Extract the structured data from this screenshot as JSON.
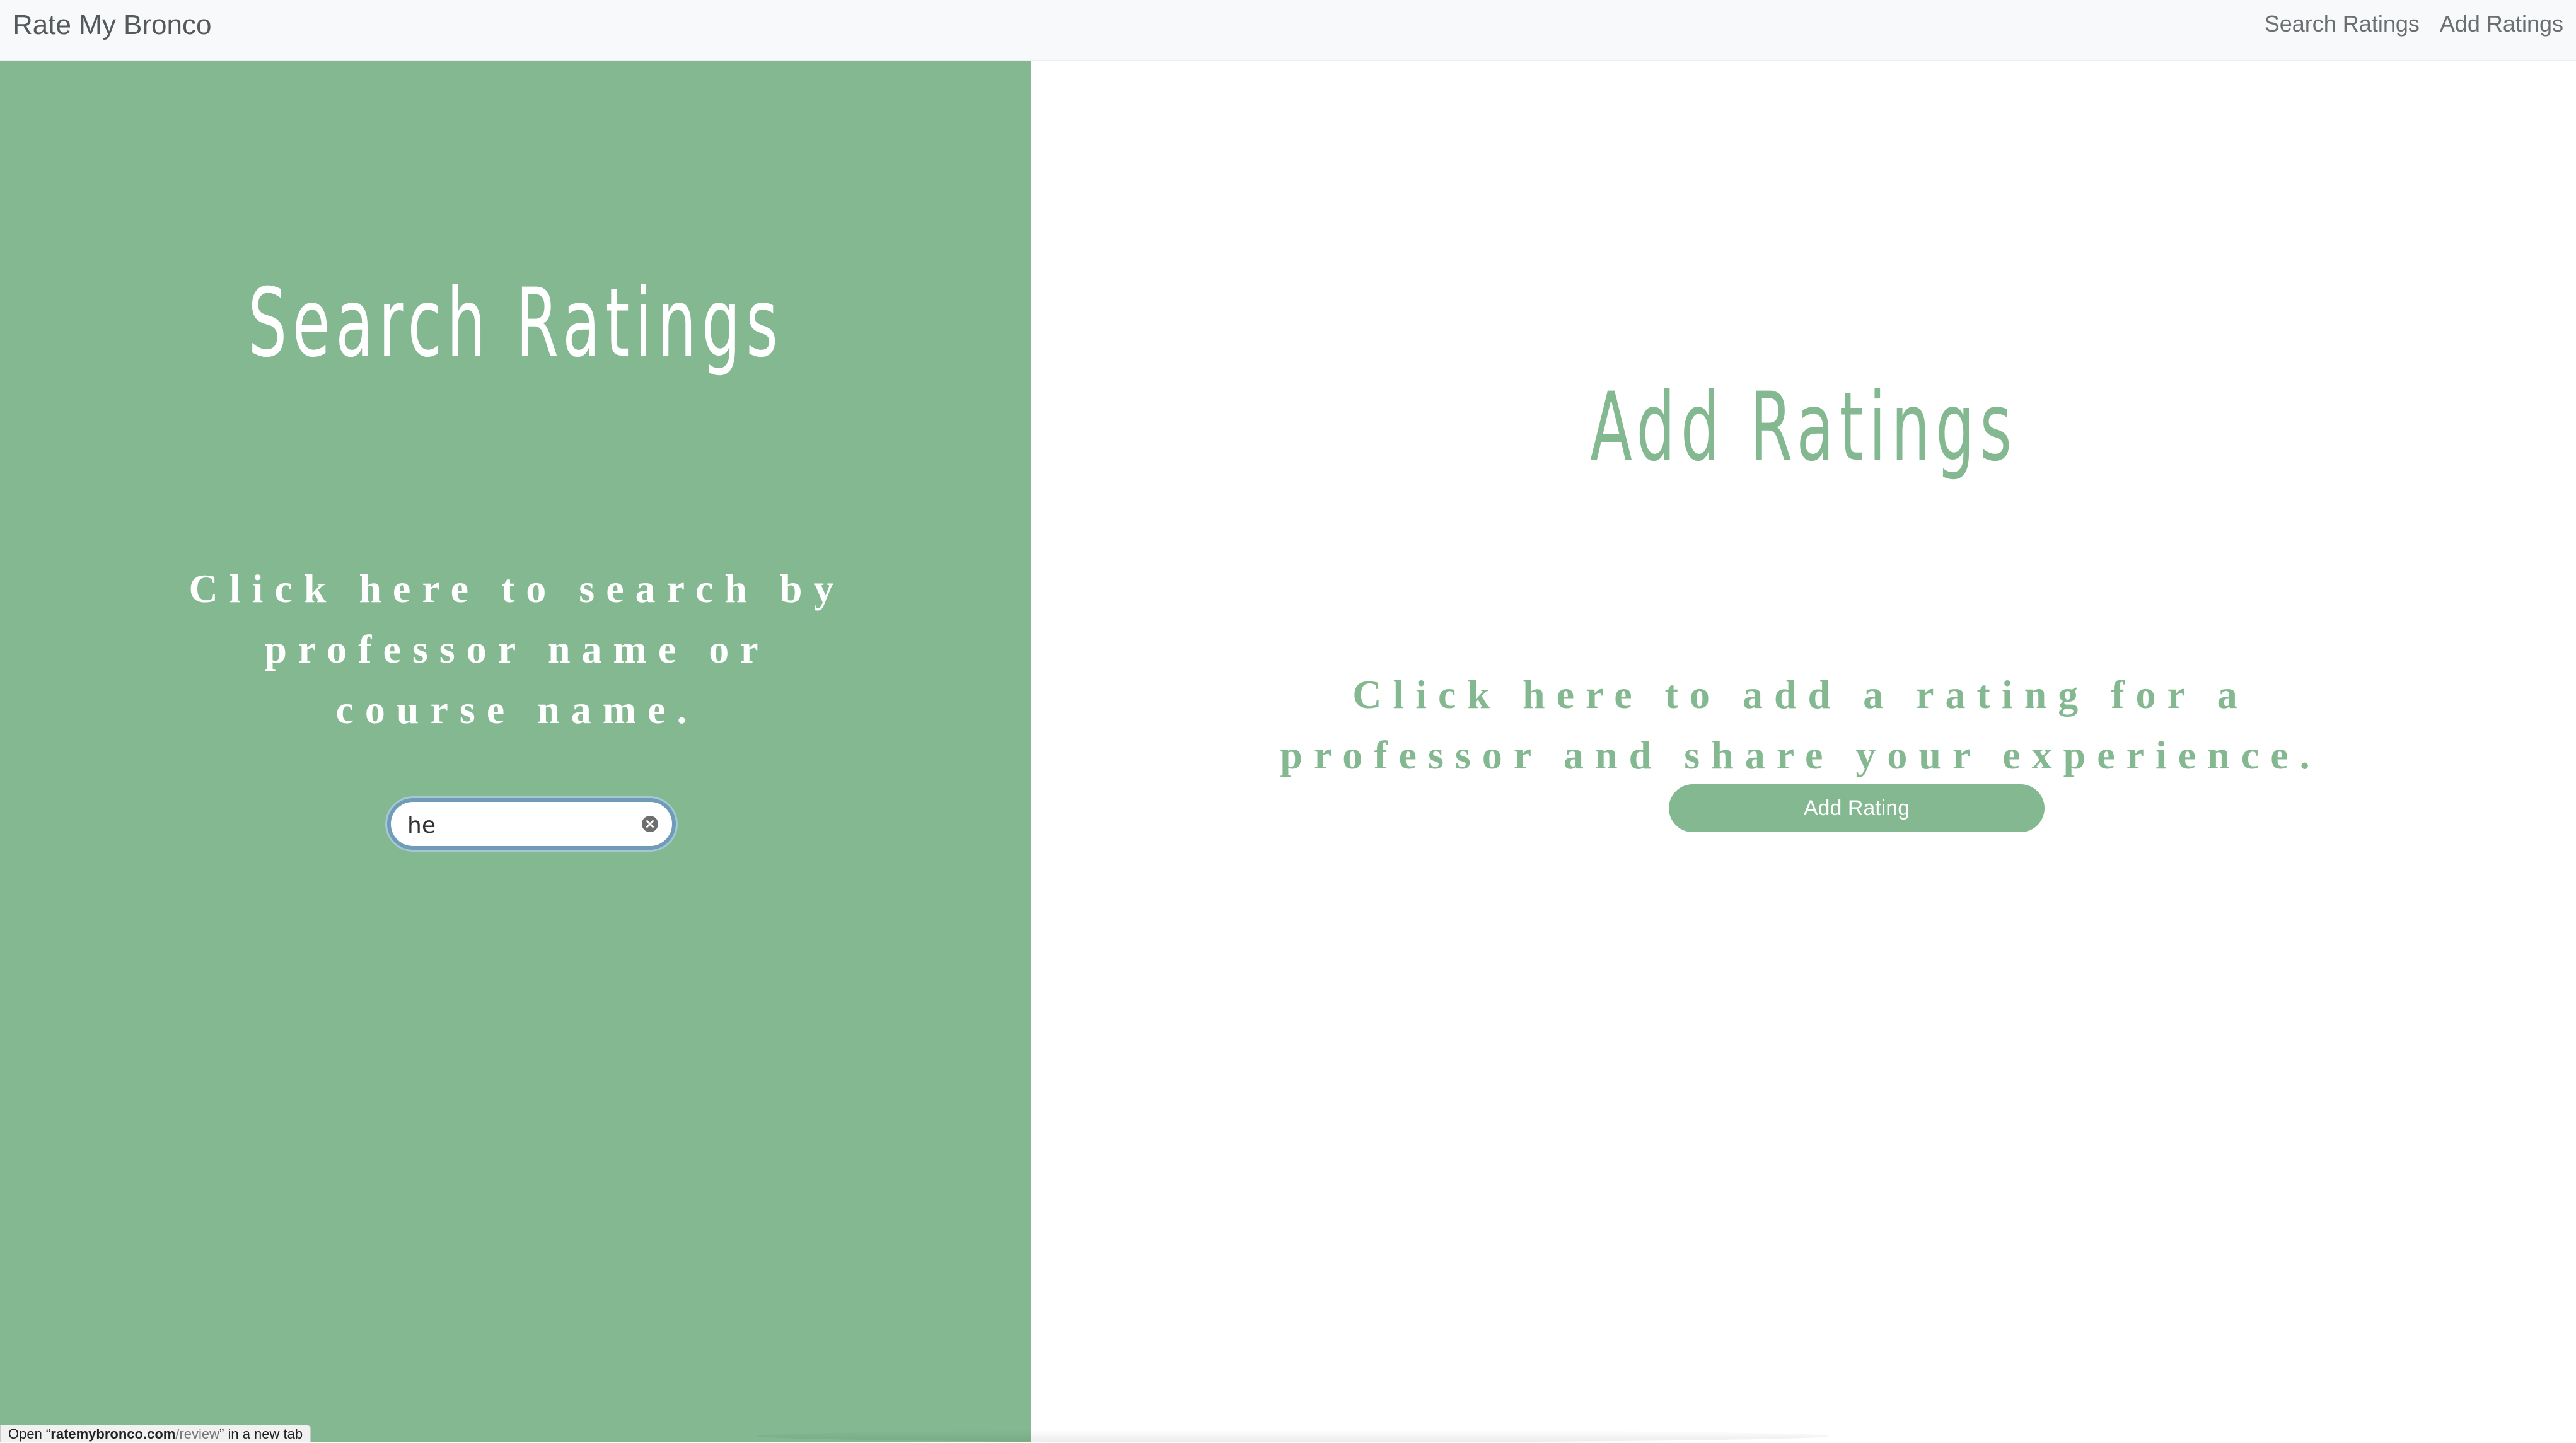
{
  "app": {
    "brand": "Rate My Bronco"
  },
  "nav": {
    "links": [
      {
        "label": "Search Ratings"
      },
      {
        "label": "Add Ratings"
      }
    ]
  },
  "search_section": {
    "title": "Search Ratings",
    "description": "Click here to search by professor name or course name.",
    "input_value": "he"
  },
  "add_section": {
    "title": "Add Ratings",
    "description": "Click here to add a rating for a professor and share your experience.",
    "button_label": "Add Rating"
  },
  "status_bar": {
    "prefix": "Open “",
    "domain": "ratemybronco.com",
    "path": "/review",
    "suffix": "” in a new tab"
  },
  "colors": {
    "accent_green": "#83b891",
    "focus_ring": "#6f9db8",
    "navbar_bg": "#f8f9fa"
  },
  "icons": {
    "clear": "clear-circle-x-icon"
  }
}
